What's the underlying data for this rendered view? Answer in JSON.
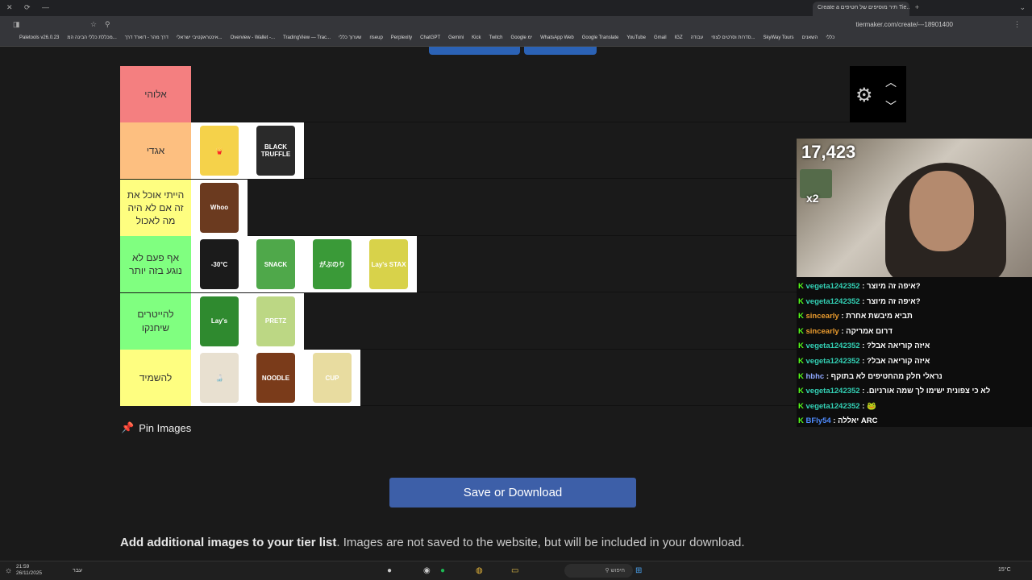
{
  "browser": {
    "tab_title": "Create a ‎תיר מוסיפים של חטיפים Tie...",
    "url": "tiermaker.com/create/---18901400",
    "bookmarks": [
      "Paletools v26.0.23",
      "מכללת כללי הבינה המ...",
      "דרך מהר - דוארד דרך",
      "אינטראקטיבי ישראלי...",
      "Overview - Wallet -...",
      "TradingView — Trac...",
      "שערוך כללי",
      "riseup",
      "Perplexity",
      "ChatGPT",
      "Gemini",
      "Kick",
      "Twitch",
      "Google ימ",
      "WhatsApp Web",
      "Google Translate",
      "YouTube",
      "Gmail",
      "IGZ",
      "עבודה",
      "סדרות וסרטים לצפי...",
      "SkyWay Tours",
      "השאנים",
      "כללי"
    ]
  },
  "tiers": [
    {
      "label": "אלוהי",
      "color": "#f47f80",
      "items": []
    },
    {
      "label": "אגדי",
      "color": "#fdbf80",
      "items": [
        {
          "name": "chips-snack",
          "bg": "#f5d24a",
          "text": "🍟"
        },
        {
          "name": "black-truffle-chips",
          "bg": "#2a2a2a",
          "text": "BLACK TRUFFLE"
        }
      ]
    },
    {
      "label": "הייתי אוכל את זה אם לא היה מה לאכול",
      "color": "#fefe80",
      "items": [
        {
          "name": "chocolate-chips",
          "bg": "#6b3a1f",
          "text": "Whoo"
        }
      ]
    },
    {
      "label": "אף פעם לא נוגע בזה יותר",
      "color": "#80ff80",
      "items": [
        {
          "name": "strawberry-chips",
          "bg": "#1b1b1b",
          "text": "-30°C"
        },
        {
          "name": "snack-bag-green",
          "bg": "#4fa84a",
          "text": "SNACK"
        },
        {
          "name": "gabunori",
          "bg": "#3a9a38",
          "text": "がぶのり"
        },
        {
          "name": "lays-stax-avocado",
          "bg": "#d8d24a",
          "text": "Lay's STAX"
        }
      ]
    },
    {
      "label": "להייטרים שיחנקו",
      "color": "#80ff80",
      "items": [
        {
          "name": "lays-green",
          "bg": "#2f8a2f",
          "text": "Lay's"
        },
        {
          "name": "pretz-sticks",
          "bg": "#bcd784",
          "text": "PRETZ"
        }
      ]
    },
    {
      "label": "להשמיד",
      "color": "#fefe80",
      "items": [
        {
          "name": "milk-bottle",
          "bg": "#e8e0d0",
          "text": "🍶"
        },
        {
          "name": "instant-noodle-cup",
          "bg": "#7a3b1a",
          "text": "NOODLE"
        },
        {
          "name": "yogurt-cup",
          "bg": "#e8dca0",
          "text": "CUP"
        }
      ]
    }
  ],
  "pin_images_label": "Pin Images",
  "save_button_label": "Save or Download",
  "add_images_bold": "Add additional images to your tier list",
  "add_images_text": ". Images are not saved to the website, but will be included in your download.",
  "stream": {
    "viewers": "17,423",
    "multiplier": "x2",
    "chat": [
      {
        "user": "vegeta1242352",
        "msg": "איפה זה מיוצר?",
        "color": "#33d1b5"
      },
      {
        "user": "vegeta1242352",
        "msg": "איפה זה מיוצר?",
        "color": "#33d1b5"
      },
      {
        "user": "sincearly",
        "msg": "תביא מיבשת אחרת",
        "color": "#e89a2e"
      },
      {
        "user": "sincearly",
        "msg": "דרום אמריקה",
        "color": "#e89a2e"
      },
      {
        "user": "vegeta1242352",
        "msg": "?איזה קוריאה אבל",
        "color": "#33d1b5"
      },
      {
        "user": "vegeta1242352",
        "msg": "?איזה קוריאה אבל",
        "color": "#33d1b5"
      },
      {
        "user": "hbhc",
        "msg": "נראלי חלק מהחטיפים לא בתוקף",
        "color": "#8fa8ff"
      },
      {
        "user": "vegeta1242352",
        "msg": ".לא כי צפונית ישימו לך שמה אורניום",
        "color": "#33d1b5"
      },
      {
        "user": "vegeta1242352",
        "msg": "🐸",
        "color": "#33d1b5"
      },
      {
        "user": "BFly54",
        "msg": "יאללה ARC",
        "color": "#4f8cff"
      }
    ]
  },
  "taskbar": {
    "time": "21:59",
    "date": "26/11/2025",
    "search_placeholder": "חיפוש",
    "weather": "15°C",
    "lang": "עבר"
  }
}
